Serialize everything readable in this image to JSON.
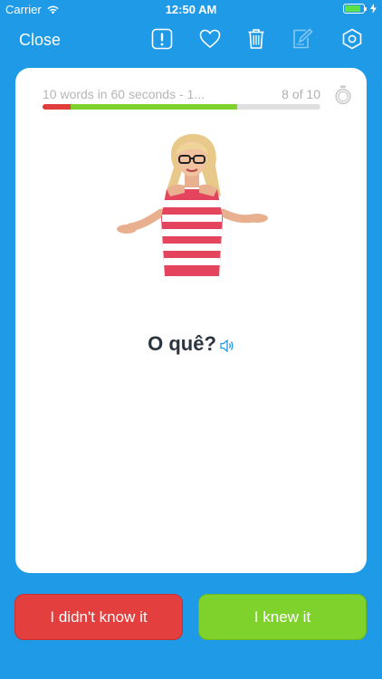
{
  "status_bar": {
    "carrier": "Carrier",
    "time": "12:50 AM"
  },
  "nav": {
    "close_label": "Close",
    "icons": [
      "report-icon",
      "heart-icon",
      "trash-icon",
      "edit-icon",
      "settings-icon"
    ]
  },
  "card": {
    "progress_title": "10 words in 60 seconds - 1...",
    "progress_count": "8 of 10",
    "progress": {
      "wrong_fraction": 0.1,
      "right_fraction": 0.6
    },
    "word": "O quê?"
  },
  "buttons": {
    "didnt_know": "I didn't know it",
    "knew": "I knew it"
  },
  "colors": {
    "background": "#1f9ae6",
    "red": "#e33f3f",
    "green": "#7fd12c"
  }
}
